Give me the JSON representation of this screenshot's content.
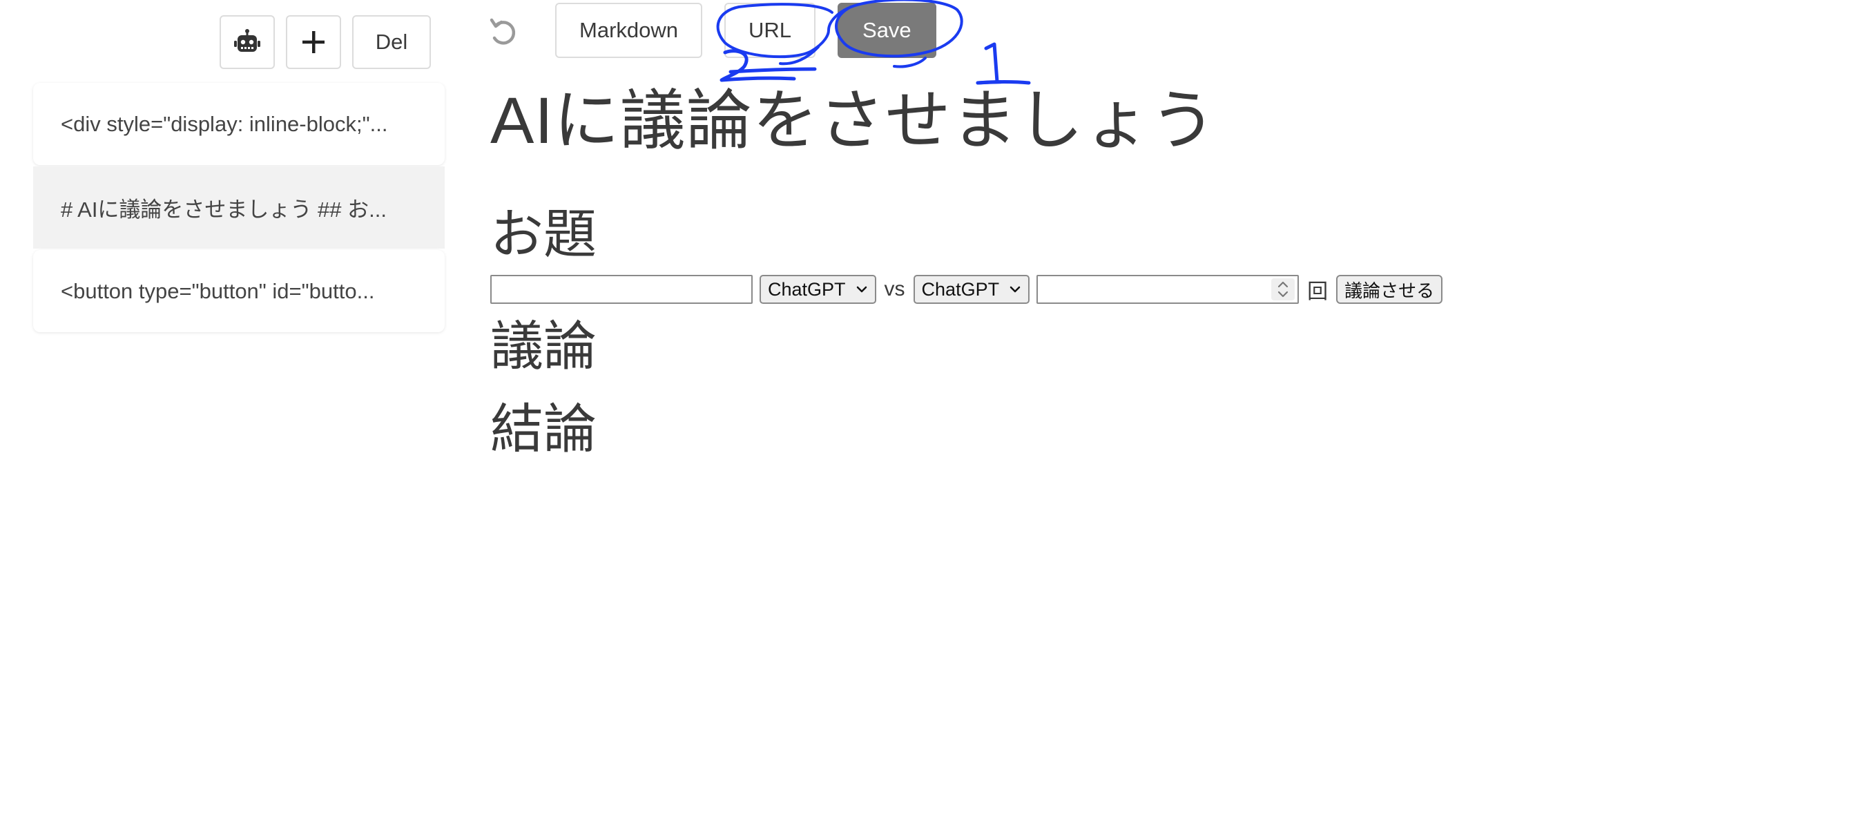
{
  "sidebar": {
    "toolbar": {
      "robot_icon": "robot-icon",
      "add_icon": "plus-icon",
      "del_label": "Del"
    },
    "notes": [
      {
        "label": "<div style=\"display: inline-block;\"..."
      },
      {
        "label": "# AIに議論をさせましょう ## お..."
      },
      {
        "label": "<button type=\"button\" id=\"butto..."
      }
    ]
  },
  "toolbar": {
    "undo_icon": "undo-icon",
    "markdown_label": "Markdown",
    "url_label": "URL",
    "save_label": "Save"
  },
  "annotations": {
    "mark_1": "1",
    "mark_2": "2",
    "color": "#1a3bf0"
  },
  "document": {
    "title": "AIに議論をさせましょう",
    "topic_heading": "お題",
    "form": {
      "topic_value": "",
      "model_a": "ChatGPT",
      "vs_label": "vs",
      "model_b": "ChatGPT",
      "rounds_value": "",
      "rounds_unit": "回",
      "submit_label": "議論させる"
    },
    "debate_heading": "議論",
    "conclusion_heading": "結論"
  },
  "colors": {
    "save_bg": "#7a7a7a",
    "text": "#3a3a3a",
    "active_note_bg": "#f2f2f2"
  }
}
